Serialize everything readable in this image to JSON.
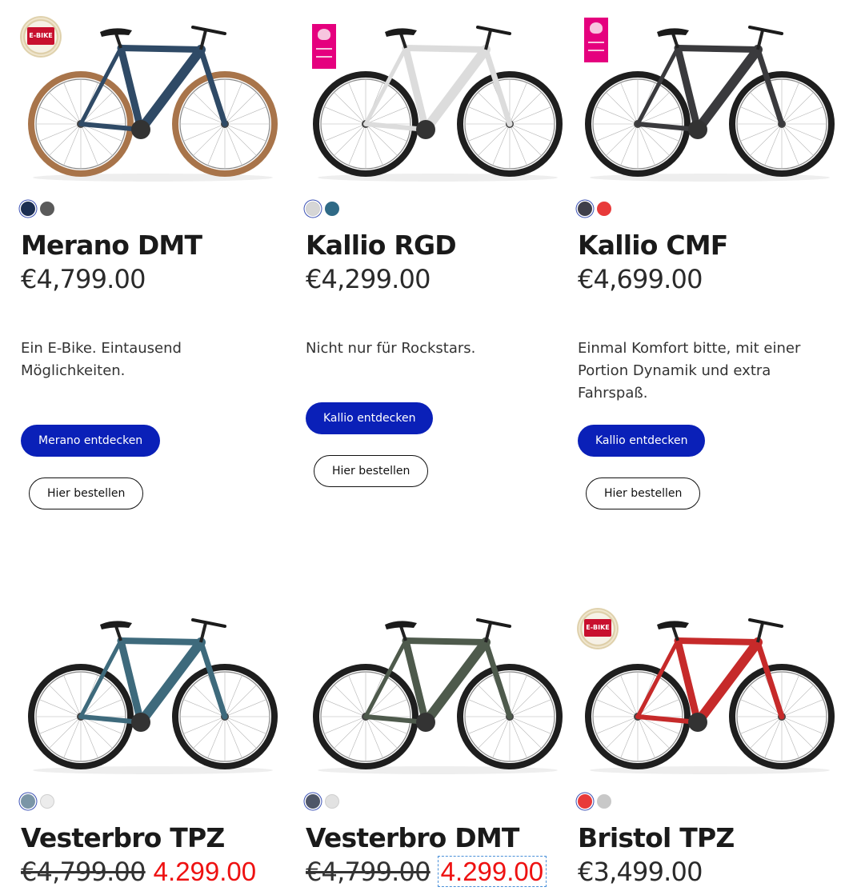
{
  "products": [
    {
      "name": "Merano DMT",
      "price": "€4,799.00",
      "description": "Ein E-Bike. Eintausend Möglichkeiten.",
      "primary_button": "Merano entdecken",
      "order_button": "Hier bestellen",
      "award": "FOCUS E-BIKE DESIGN AWARD",
      "colors": [
        "#1c2f52",
        "#5a5a5a"
      ],
      "frame_color": "#2f4a66",
      "tire_color": "#a8744a"
    },
    {
      "name": "Kallio RGD",
      "price": "€4,299.00",
      "description": "Nicht nur für Rockstars.",
      "primary_button": "Kallio entdecken",
      "order_button": "Hier bestellen",
      "award": "EUROBIKE AWARD WINNER",
      "colors": [
        "#d6d6d6",
        "#2f6a86"
      ],
      "frame_color": "#dcdcdc",
      "tire_color": "#1e1e1e"
    },
    {
      "name": "Kallio CMF",
      "price": "€4,699.00",
      "description": "Einmal Komfort bitte, mit einer Portion Dynamik und extra Fahrspaß.",
      "primary_button": "Kallio entdecken",
      "order_button": "Hier bestellen",
      "award": "EUROBIKE AWARD WINNER",
      "colors": [
        "#3f3f4a",
        "#e83a3a"
      ],
      "frame_color": "#3a3a3d",
      "tire_color": "#1e1e1e"
    },
    {
      "name": "Vesterbro TPZ",
      "price_old": "€4,799.00",
      "price_sale": "4.299.00",
      "colors": [
        "#7a95a6",
        "#ececec"
      ],
      "frame_color": "#3e6a7c",
      "tire_color": "#1e1e1e"
    },
    {
      "name": "Vesterbro DMT",
      "price_old": "€4,799.00",
      "price_sale": "4.299.00",
      "colors": [
        "#4f5668",
        "#e2e2e2"
      ],
      "frame_color": "#4e5a4c",
      "tire_color": "#1e1e1e"
    },
    {
      "name": "Bristol TPZ",
      "price": "€3,499.00",
      "award": "FOCUS E-BIKE DESIGN AWARD",
      "colors": [
        "#e83a3a",
        "#c8c8c8"
      ],
      "frame_color": "#c62a2a",
      "tire_color": "#1e1e1e"
    }
  ]
}
